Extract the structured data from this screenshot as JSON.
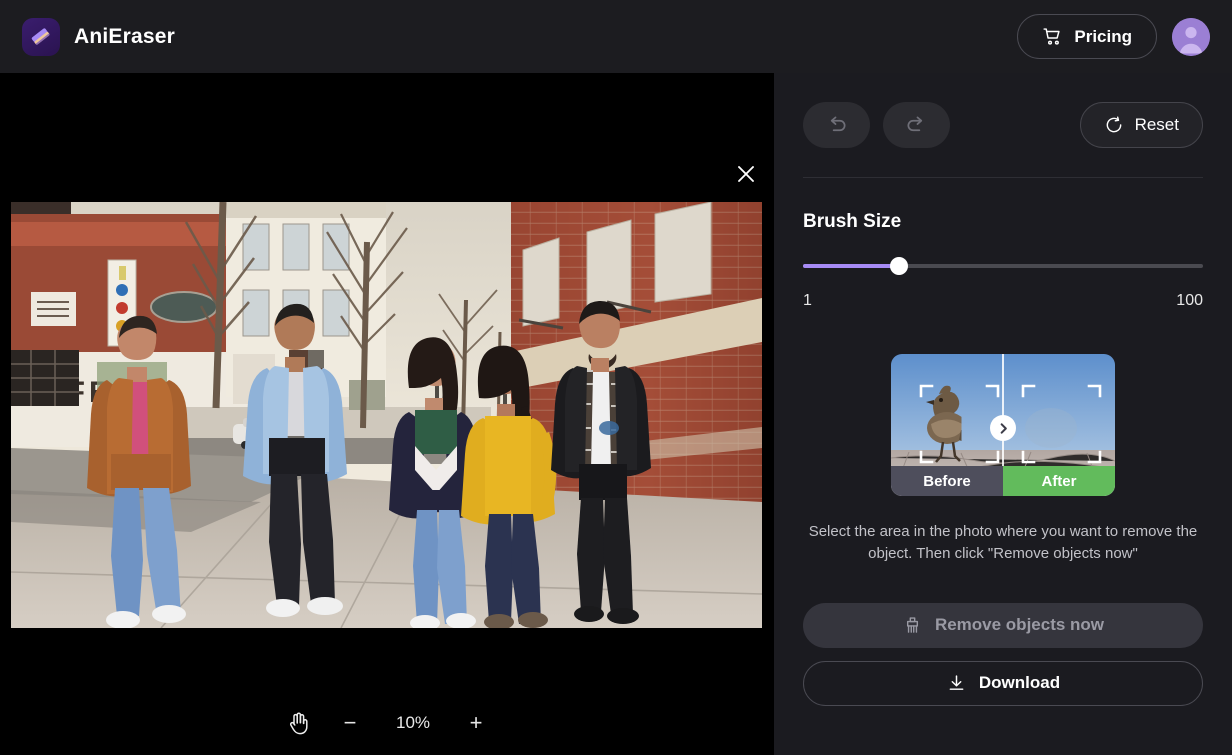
{
  "header": {
    "brand_name": "AniEraser",
    "logo_icon": "eraser-icon",
    "pricing_label": "Pricing",
    "pricing_icon": "shopping-cart-icon",
    "avatar_icon": "user-avatar-icon"
  },
  "canvas": {
    "close_icon": "close-icon",
    "photo_alt": "five-friends-walking-on-city-sidewalk",
    "zoom": {
      "pan_icon": "hand-pan-icon",
      "zoom_out_label": "−",
      "zoom_level": "10%",
      "zoom_in_label": "+"
    }
  },
  "panel": {
    "undo_icon": "undo-icon",
    "redo_icon": "redo-icon",
    "reset_label": "Reset",
    "reset_icon": "reset-circular-arrow-icon",
    "brush": {
      "title": "Brush Size",
      "min_label": "1",
      "max_label": "100",
      "value_percent": 24
    },
    "preview": {
      "before_label": "Before",
      "after_label": "After",
      "handle_icon": "chevron-right-icon",
      "subject": "bird-on-wooden-plank"
    },
    "hint": "Select the area in the photo where you want to remove the object. Then click \"Remove objects now\"",
    "remove_label": "Remove objects now",
    "remove_icon": "brush-cleanup-icon",
    "download_label": "Download",
    "download_icon": "download-arrow-icon"
  },
  "colors": {
    "accent_purple": "#a78bf5",
    "after_green": "#62bb5c",
    "before_slate": "#4e4e5c",
    "panel_bg": "#1b1b20",
    "header_bg": "#1c1c20",
    "canvas_bg": "#000000"
  }
}
